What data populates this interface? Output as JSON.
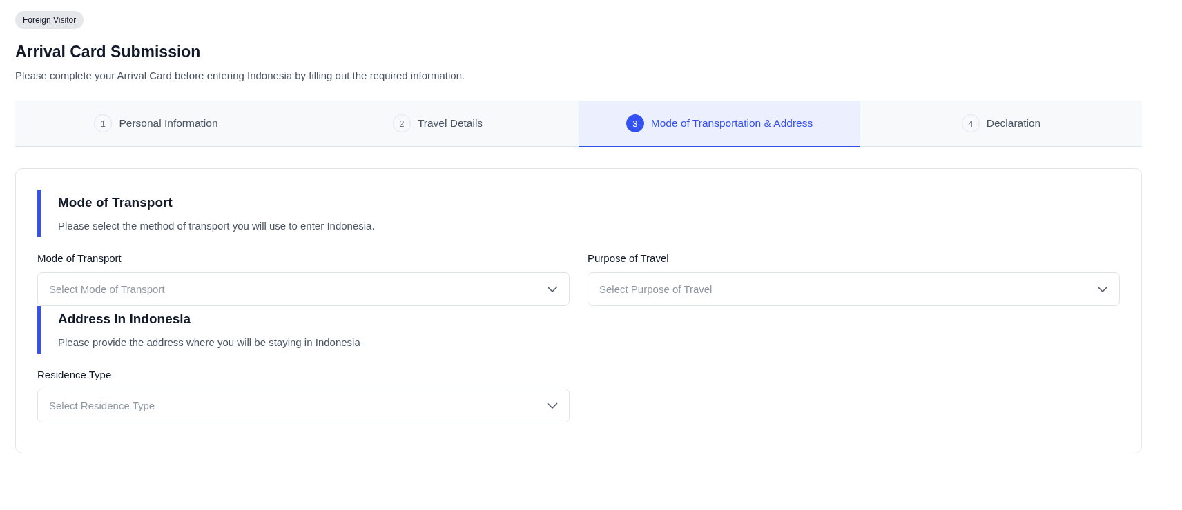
{
  "badge": "Foreign Visitor",
  "title": "Arrival Card Submission",
  "subtitle": "Please complete your Arrival Card before entering Indonesia by filling out the required information.",
  "steps": [
    {
      "number": "1",
      "label": "Personal Information",
      "selected": false
    },
    {
      "number": "2",
      "label": "Travel Details",
      "selected": false
    },
    {
      "number": "3",
      "label": "Mode of Transportation & Address",
      "selected": true
    },
    {
      "number": "4",
      "label": "Declaration",
      "selected": false
    }
  ],
  "sections": [
    {
      "heading": "Mode of Transport",
      "description": "Please select the method of transport you will use to enter Indonesia.",
      "fields": [
        {
          "label": "Mode of Transport",
          "placeholder": "Select Mode of Transport"
        },
        {
          "label": "Purpose of Travel",
          "placeholder": "Select Purpose of Travel"
        }
      ]
    },
    {
      "heading": "Address in Indonesia",
      "description": "Please provide the address where you will be staying in Indonesia",
      "fields": [
        {
          "label": "Residence Type",
          "placeholder": "Select Residence Type"
        }
      ]
    }
  ]
}
